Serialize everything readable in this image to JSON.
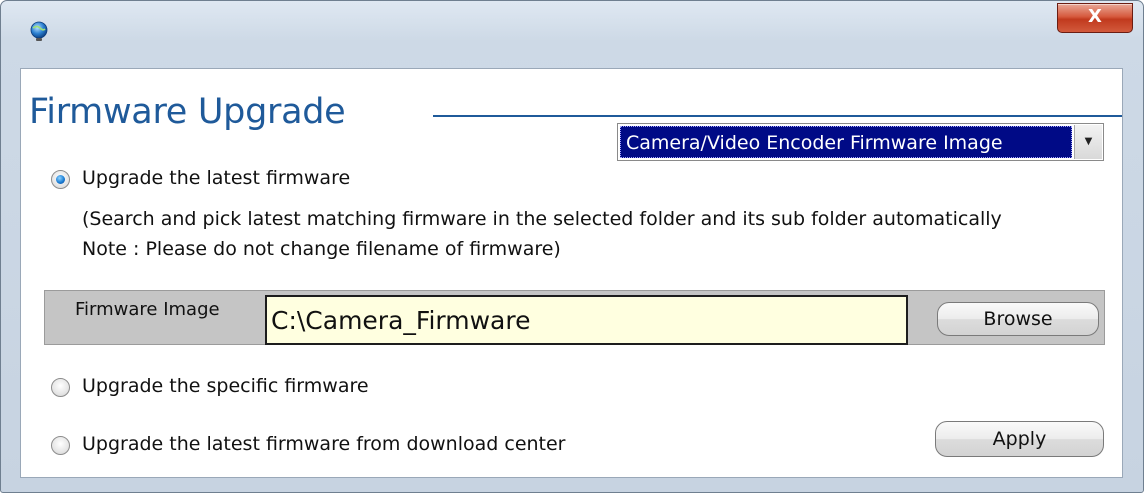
{
  "window": {
    "close_label": "X"
  },
  "header": {
    "title": "Firmware Upgrade",
    "image_type": {
      "selected": "Camera/Video Encoder Firmware Image"
    }
  },
  "options": {
    "latest": {
      "label": "Upgrade the latest firmware",
      "checked": true,
      "note": "(Search and pick latest matching firmware in the selected folder and its sub folder automatically Note : Please do not change filename of firmware)"
    },
    "specific": {
      "label": "Upgrade the specific firmware",
      "checked": false
    },
    "download_center": {
      "label": "Upgrade the latest firmware from download center",
      "checked": false
    }
  },
  "firmware_image": {
    "label": "Firmware Image",
    "path": "C:\\Camera_Firmware",
    "browse_label": "Browse"
  },
  "actions": {
    "apply_label": "Apply"
  },
  "colors": {
    "title_blue": "#1f5a9a",
    "selection_navy": "#000a86",
    "input_background": "#ffffe0",
    "close_red": "#c13a1e"
  },
  "icons": {
    "app": "globe-icon",
    "close": "close-icon",
    "dropdown": "chevron-down-icon"
  }
}
